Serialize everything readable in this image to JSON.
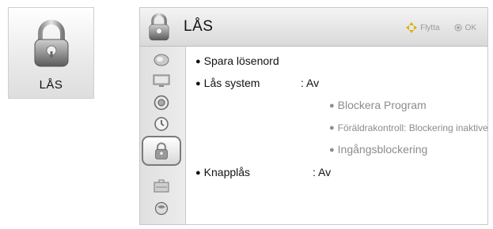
{
  "tile": {
    "label": "LÅS",
    "icon": "lock-icon"
  },
  "header": {
    "title": "LÅS",
    "hint_move": "Flytta",
    "hint_ok": "OK"
  },
  "sidebar": {
    "items": [
      {
        "icon": "satellite-dish-icon",
        "active": false
      },
      {
        "icon": "tv-screen-icon",
        "active": false
      },
      {
        "icon": "speaker-icon",
        "active": false
      },
      {
        "icon": "clock-icon",
        "active": false
      },
      {
        "icon": "lock-icon",
        "active": true
      },
      {
        "icon": "toolbox-icon",
        "active": false
      },
      {
        "icon": "network-icon",
        "active": false
      }
    ]
  },
  "menu": {
    "set_password": "Spara lösenord",
    "lock_system": "Lås system",
    "lock_system_value": ": Av",
    "block_program": "Blockera Program",
    "parental_control": "Föräldrakontroll: Blockering inaktiverad",
    "input_block": "Ingångsblockering",
    "key_lock": "Knapplås",
    "key_lock_value": ": Av"
  },
  "colors": {
    "accent": "#7a7a7a",
    "dim_text": "#8c8c8c"
  }
}
